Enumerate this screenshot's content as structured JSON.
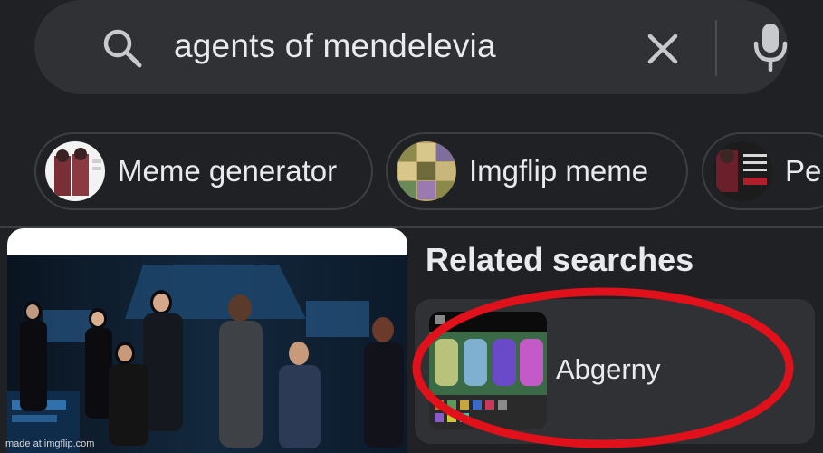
{
  "search": {
    "query": "agents of mendelevia"
  },
  "chips": [
    {
      "label": "Meme generator"
    },
    {
      "label": "Imgflip meme"
    },
    {
      "label": "Per"
    }
  ],
  "related": {
    "heading": "Related searches",
    "items": [
      {
        "label": "Abgerny"
      }
    ]
  },
  "watermark": "made at imgflip.com",
  "colors": {
    "background": "#202124",
    "surface": "#303134",
    "text": "#e8eaed",
    "annotation": "#e0111b"
  }
}
